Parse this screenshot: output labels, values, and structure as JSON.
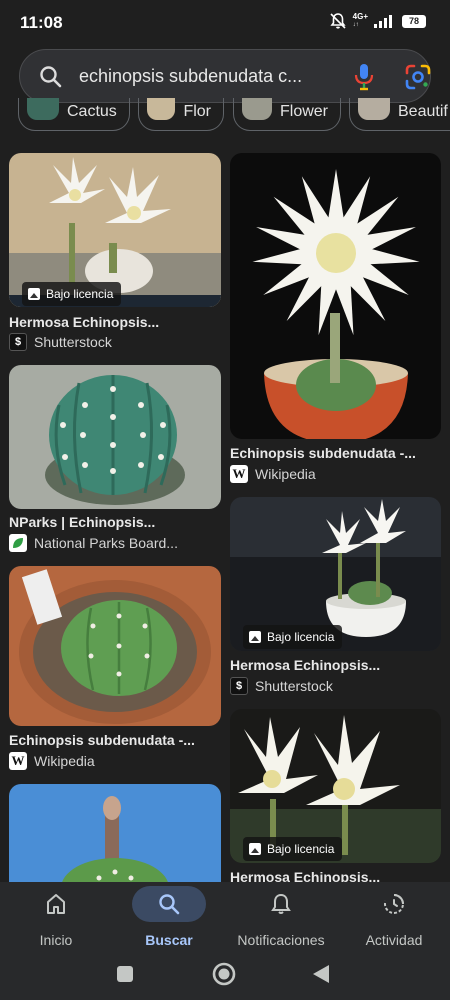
{
  "status": {
    "time": "11:08",
    "network": "4G+",
    "battery": "78"
  },
  "search": {
    "query": "echinopsis subdenudata c..."
  },
  "chips": [
    {
      "label": "Cactus"
    },
    {
      "label": "Flor"
    },
    {
      "label": "Flower"
    },
    {
      "label": "Beautif"
    }
  ],
  "results": [
    {
      "title": "Hermosa Echinopsis...",
      "source": "Shutterstock",
      "badge": "Bajo licencia"
    },
    {
      "title": "Echinopsis subdenudata -...",
      "source": "Wikipedia"
    },
    {
      "title": "NParks | Echinopsis...",
      "source": "National Parks Board..."
    },
    {
      "title": "Hermosa Echinopsis...",
      "source": "Shutterstock",
      "badge": "Bajo licencia"
    },
    {
      "title": "Echinopsis subdenudata -...",
      "source": "Wikipedia"
    },
    {
      "title": "Hermosa Echinopsis...",
      "badge": "Bajo licencia"
    }
  ],
  "nav": [
    {
      "label": "Inicio",
      "icon": "home-icon"
    },
    {
      "label": "Buscar",
      "icon": "search-icon",
      "active": true
    },
    {
      "label": "Notificaciones",
      "icon": "bell-icon"
    },
    {
      "label": "Actividad",
      "icon": "activity-icon"
    }
  ],
  "colors": {
    "accent": "#a8c7fa",
    "active_pill": "#3b4a63",
    "background": "#1f1f1f"
  }
}
